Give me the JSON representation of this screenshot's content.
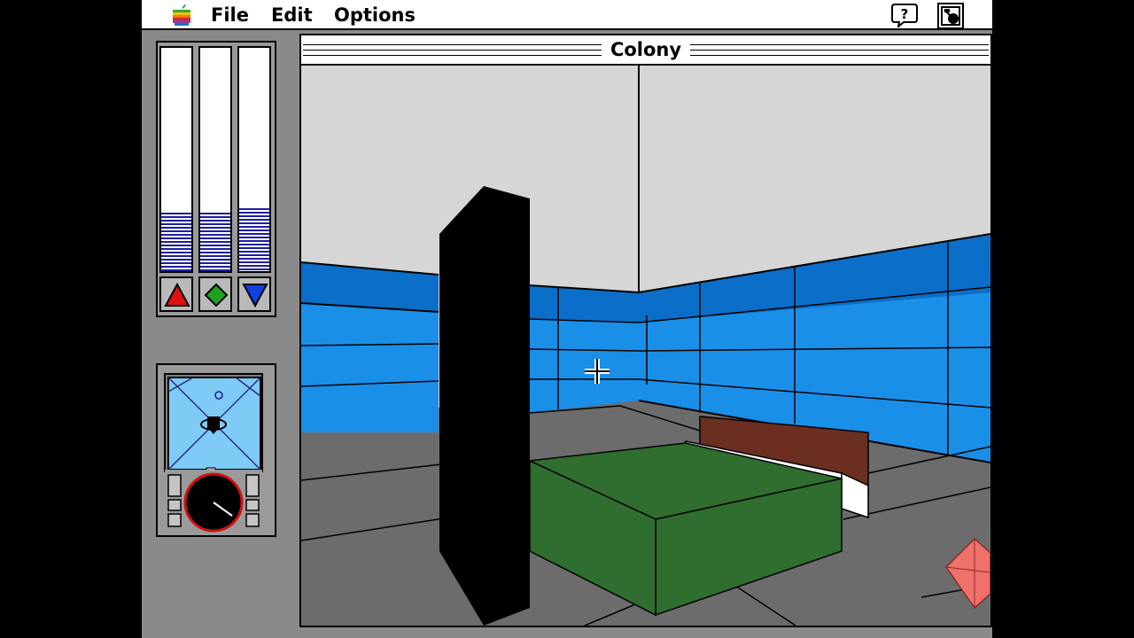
{
  "menubar": {
    "items": [
      {
        "label": "File"
      },
      {
        "label": "Edit"
      },
      {
        "label": "Options"
      }
    ],
    "icons": [
      "apple-icon",
      "help-balloon-icon",
      "application-icon"
    ]
  },
  "window": {
    "title": "Colony"
  },
  "power_gauges": {
    "levels": [
      0.26,
      0.26,
      0.28
    ],
    "fill_color": "#1e1e9e",
    "buttons": [
      {
        "icon": "red-triangle-up-icon",
        "color": "#e01010"
      },
      {
        "icon": "green-diamond-icon",
        "color": "#20a020"
      },
      {
        "icon": "blue-triangle-down-icon",
        "color": "#1040e0"
      }
    ]
  },
  "radar": {
    "screen_color": "#7ecbf5",
    "compass_ring_color": "#d01010"
  },
  "scene": {
    "ceiling_color": "#d6d6d6",
    "wall_color": "#1a8fe8",
    "wall_band_color": "#0b6ec8",
    "floor_color": "#6c6c6c",
    "bed_color": "#2f6e2f",
    "headboard_color": "#6b2f22",
    "pillar_color": "#000000",
    "crystal_color": "#f0706a"
  }
}
